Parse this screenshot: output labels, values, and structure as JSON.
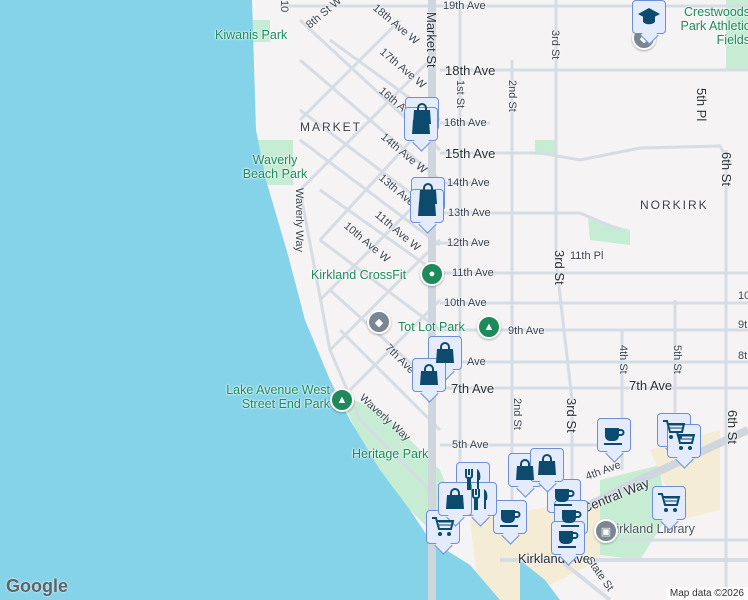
{
  "map": {
    "neighborhoods": [
      "MARKET",
      "NORKIRK"
    ],
    "parks": [
      "Kiwanis Park",
      "Waverly Beach Park",
      "Lake Avenue West Street End Park",
      "Heritage Park",
      "Crestwoods Park Athletic Fields"
    ],
    "places": {
      "crossfit": "Kirkland CrossFit",
      "totlot": "Tot Lot Park",
      "library": "Kirkland Library"
    },
    "avenues": [
      "19th Ave",
      "18th Ave",
      "16th Ave",
      "15th Ave",
      "14th Ave",
      "13th Ave",
      "12th Ave",
      "11th Ave",
      "10th Ave",
      "9th Ave",
      "Ave",
      "7th Ave",
      "7th Ave",
      "5th Ave",
      "11th Pl",
      "4th Ave",
      "Central Way",
      "Kirkland Ave",
      "State St",
      "10",
      "9t",
      "8t"
    ],
    "streets": [
      "Market St",
      "1st St",
      "2nd St",
      "3rd St",
      "3rd St",
      "2nd St",
      "3rd St",
      "4th St",
      "5th St",
      "5th Pl",
      "6th St",
      "6th St",
      "5",
      "Waverly Way",
      "Waverly Way",
      "8th St W",
      "10"
    ],
    "west_avenues": [
      "18th Ave W",
      "17th Ave W",
      "16th Ave W",
      "14th Ave W",
      "13th Ave W",
      "11th Ave W",
      "10th Ave W",
      "7th Ave W"
    ],
    "markers": [
      "shopping",
      "shopping",
      "shopping",
      "shopping",
      "shopping",
      "shopping",
      "school",
      "coffee",
      "grocery",
      "grocery",
      "grocery",
      "grocery",
      "coffee",
      "coffee",
      "coffee",
      "coffee",
      "restaurant",
      "restaurant",
      "shopping",
      "shopping",
      "shopping"
    ],
    "colors": {
      "water": "#85d3e9",
      "land": "#f5f3f3",
      "road": "#d5dce4",
      "park": "#c6ecd4",
      "marker": "#0c4a6e"
    }
  },
  "footer": {
    "logo": "Google",
    "attribution": "Map data ©2026"
  }
}
